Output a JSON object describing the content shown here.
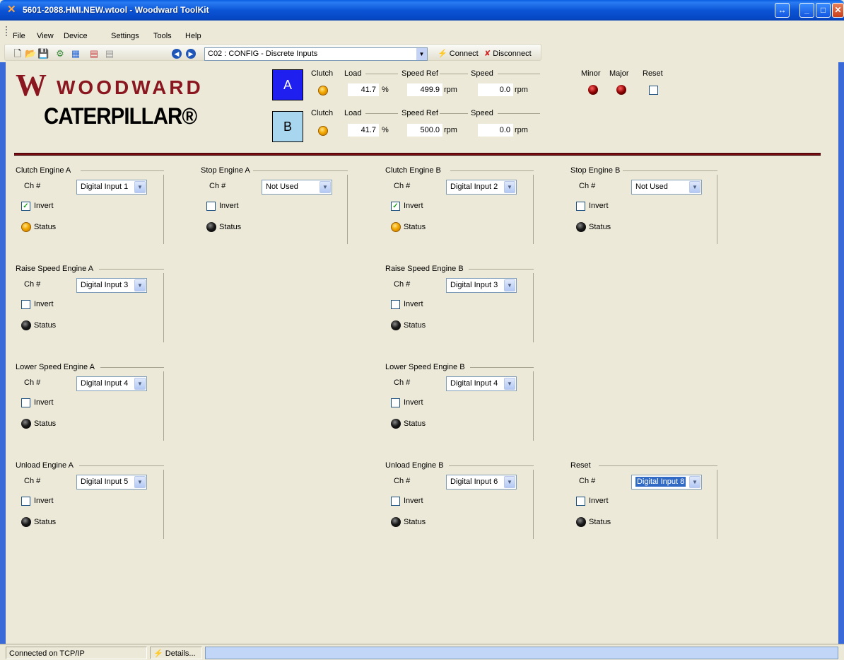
{
  "window": {
    "title": "5601-2088.HMI.NEW.wtool - Woodward ToolKit",
    "colors": {
      "titlebar": "#0b55d6",
      "accent": "#7a0d12"
    }
  },
  "menu": {
    "items": [
      "File",
      "View",
      "Device",
      "Settings",
      "Tools",
      "Help"
    ]
  },
  "toolbar": {
    "page_select": "C02 : CONFIG - Discrete Inputs",
    "connect_label": "Connect",
    "disconnect_label": "Disconnect"
  },
  "logos": {
    "woodward": "WOODWARD",
    "caterpillar": "CATERPILLAR®"
  },
  "engines": [
    {
      "button": "A",
      "clutch_label": "Clutch",
      "load_label": "Load",
      "load": "41.7",
      "load_unit": "%",
      "speed_ref_label": "Speed Ref",
      "speed_ref": "499.9",
      "speed_ref_unit": "rpm",
      "speed_label": "Speed",
      "speed": "0.0",
      "speed_unit": "rpm",
      "clutch_led": "orange"
    },
    {
      "button": "B",
      "clutch_label": "Clutch",
      "load_label": "Load",
      "load": "41.7",
      "load_unit": "%",
      "speed_ref_label": "Speed Ref",
      "speed_ref": "500.0",
      "speed_ref_unit": "rpm",
      "speed_label": "Speed",
      "speed": "0.0",
      "speed_unit": "rpm",
      "clutch_led": "orange"
    }
  ],
  "alarms": {
    "minor_label": "Minor",
    "major_label": "Major",
    "reset_label": "Reset"
  },
  "common": {
    "ch_label": "Ch #",
    "invert_label": "Invert",
    "status_label": "Status"
  },
  "groups": {
    "clutch_a": {
      "title": "Clutch Engine A",
      "channel": "Digital Input 1",
      "invert": true,
      "status": "orange"
    },
    "stop_a": {
      "title": "Stop Engine A",
      "channel": "Not Used",
      "invert": false,
      "status": "black"
    },
    "clutch_b": {
      "title": "Clutch Engine B",
      "channel": "Digital Input 2",
      "invert": true,
      "status": "orange"
    },
    "stop_b": {
      "title": "Stop Engine B",
      "channel": "Not Used",
      "invert": false,
      "status": "black"
    },
    "raise_a": {
      "title": "Raise Speed Engine A",
      "channel": "Digital Input 3",
      "invert": false,
      "status": "black"
    },
    "raise_b": {
      "title": "Raise Speed Engine B",
      "channel": "Digital Input 3",
      "invert": false,
      "status": "black"
    },
    "lower_a": {
      "title": "Lower Speed Engine A",
      "channel": "Digital Input 4",
      "invert": false,
      "status": "black"
    },
    "lower_b": {
      "title": "Lower Speed Engine B",
      "channel": "Digital Input 4",
      "invert": false,
      "status": "black"
    },
    "unload_a": {
      "title": "Unload Engine A",
      "channel": "Digital Input 5",
      "invert": false,
      "status": "black"
    },
    "unload_b": {
      "title": "Unload Engine B",
      "channel": "Digital Input 6",
      "invert": false,
      "status": "black"
    },
    "reset": {
      "title": "Reset",
      "channel": "Digital Input 8",
      "invert": false,
      "status": "black"
    }
  },
  "statusbar": {
    "connection": "Connected on TCP/IP",
    "details": "Details..."
  }
}
